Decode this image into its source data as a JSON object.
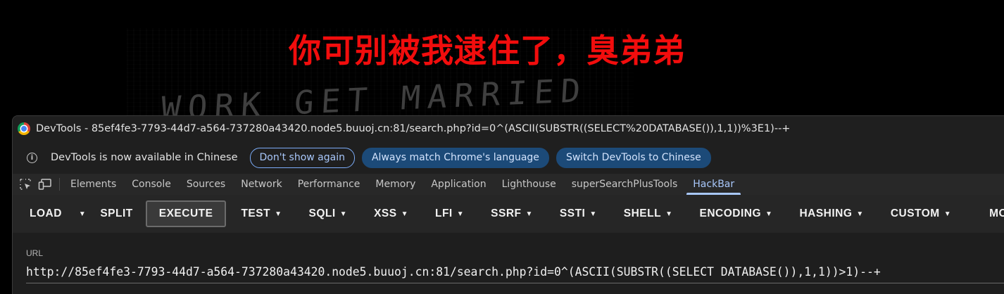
{
  "page": {
    "headline": "你可别被我逮住了，臭弟弟",
    "background_text": "WORK GET MARRIED",
    "headline_color": "#f20d0d"
  },
  "window": {
    "title": "DevTools - 85ef4fe3-7793-44d7-a564-737280a43420.node5.buuoj.cn:81/search.php?id=0^(ASCII(SUBSTR((SELECT%20DATABASE()),1,1))%3E1)--+",
    "icon": "chrome-icon"
  },
  "infobar": {
    "icon": "info-icon",
    "message": "DevTools is now available in Chinese",
    "buttons": [
      "Don't show again",
      "Always match Chrome's language",
      "Switch DevTools to Chinese"
    ]
  },
  "devtools_tabs": {
    "icons": [
      "inspect-element-icon",
      "device-toolbar-icon"
    ],
    "tabs": [
      "Elements",
      "Console",
      "Sources",
      "Network",
      "Performance",
      "Memory",
      "Application",
      "Lighthouse",
      "superSearchPlusTools",
      "HackBar"
    ],
    "active_tab": "HackBar",
    "accent_color": "#a8c7fa"
  },
  "hackbar": {
    "load": "LOAD",
    "split": "SPLIT",
    "execute": "EXECUTE",
    "menus": [
      "TEST",
      "SQLI",
      "XSS",
      "LFI",
      "SSRF",
      "SSTI",
      "SHELL",
      "ENCODING",
      "HASHING",
      "CUSTOM"
    ],
    "overflow_label": "MO",
    "url_label": "URL",
    "url_value": "http://85ef4fe3-7793-44d7-a564-737280a43420.node5.buuoj.cn:81/search.php?id=0^(ASCII(SUBSTR((SELECT DATABASE()),1,1))>1)--+"
  }
}
